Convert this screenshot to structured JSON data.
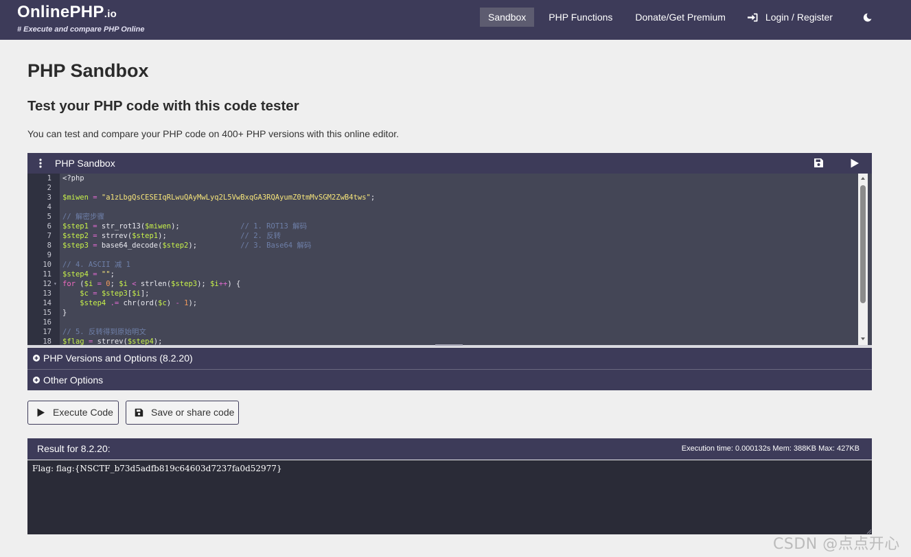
{
  "colors": {
    "navbar": "#3d3b59",
    "nav_active": "#5d5c70",
    "editor_bg": "#444656",
    "gutter_bg": "#2f3140",
    "result_bg": "#2a2b37",
    "page_bg": "#efefef"
  },
  "brand": {
    "name": "OnlinePHP",
    "suffix": ".io",
    "tagline": "# Execute and compare PHP Online"
  },
  "nav": {
    "items": [
      {
        "label": "Sandbox",
        "active": true
      },
      {
        "label": "PHP Functions",
        "active": false
      },
      {
        "label": "Donate/Get Premium",
        "active": false
      },
      {
        "label": "Login / Register",
        "active": false,
        "icon": "sign-in-icon"
      }
    ],
    "theme_toggle_icon": "moon-icon"
  },
  "page": {
    "title": "PHP Sandbox",
    "subtitle": "Test your PHP code with this code tester",
    "description": "You can test and compare your PHP code on 400+ PHP versions with this online editor."
  },
  "editor": {
    "title": "PHP Sandbox",
    "menu_icon": "kebab-icon",
    "save_icon": "floppy-disk-icon",
    "run_icon": "play-icon",
    "lines": [
      "<?php",
      "",
      "$miwen = \"a1zLbgQsCESEIqRLwuQAyMwLyq2L5VwBxqGA3RQAyumZ0tmMvSGM2ZwB4tws\";",
      "",
      "// 解密步骤",
      "$step1 = str_rot13($miwen);              // 1. ROT13 解码",
      "$step2 = strrev($step1);                 // 2. 反转",
      "$step3 = base64_decode($step2);          // 3. Base64 解码",
      "",
      "// 4. ASCII 减 1",
      "$step4 = \"\";",
      "for ($i = 0; $i < strlen($step3); $i++) {",
      "    $c = $step3[$i];",
      "    $step4 .= chr(ord($c) - 1);",
      "}",
      "",
      "// 5. 反转得到原始明文",
      "$flag = strrev($step4);"
    ],
    "line_numbers": [
      "1",
      "2",
      "3",
      "4",
      "5",
      "6",
      "7",
      "8",
      "9",
      "10",
      "11",
      "12",
      "13",
      "14",
      "15",
      "16",
      "17",
      "18"
    ]
  },
  "accordions": [
    {
      "label": "PHP Versions and Options (8.2.20)",
      "icon": "plus-circle-icon"
    },
    {
      "label": "Other Options",
      "icon": "plus-circle-icon"
    }
  ],
  "buttons": {
    "execute": {
      "label": "Execute Code",
      "icon": "play-icon"
    },
    "save": {
      "label": "Save or share code",
      "icon": "floppy-disk-icon"
    }
  },
  "result": {
    "title": "Result for 8.2.20:",
    "stats": "Execution time: 0.000132s Mem: 388KB Max: 427KB",
    "output": "Flag: flag:{NSCTF_b73d5adfb819c64603d7237fa0d52977}"
  },
  "watermark": "CSDN @点点开心"
}
